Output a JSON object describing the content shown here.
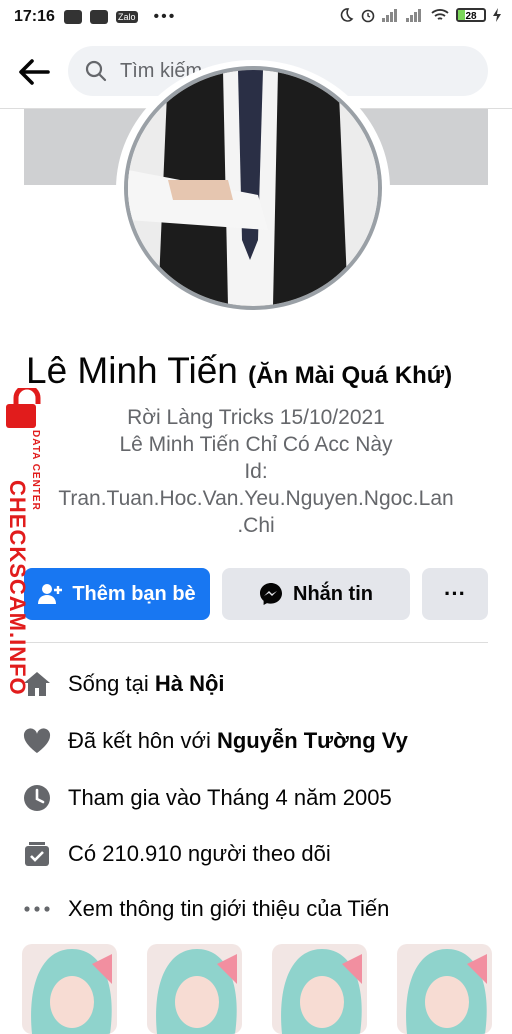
{
  "status_bar": {
    "time": "17:16",
    "battery": "28"
  },
  "search": {
    "placeholder": "Tìm kiếm"
  },
  "profile": {
    "name": "Lê Minh Tiến",
    "alternate_name": "(Ăn Mài Quá Khứ)",
    "bio_lines": [
      "Rời Làng Tricks 15/10/2021",
      "Lê Minh Tiến Chỉ Có Acc Này",
      "Id:",
      "Tran.Tuan.Hoc.Van.Yeu.Nguyen.Ngoc.Lan",
      ".Chi"
    ]
  },
  "actions": {
    "add_friend": "Thêm bạn bè",
    "message": "Nhắn tin",
    "more": "···"
  },
  "details": {
    "lives_prefix": "Sống tại ",
    "lives_place": "Hà Nội",
    "married_prefix": "Đã kết hôn với ",
    "married_name": "Nguyễn Tường Vy",
    "joined": "Tham gia vào Tháng 4 năm 2005",
    "followers": "Có 210.910 người theo dõi",
    "see_about": "Xem thông tin giới thiệu của Tiến"
  },
  "watermark": {
    "main": "CHECKSCAM.INFO",
    "sub": "DATA CENTER"
  },
  "colors": {
    "primary": "#1877f2",
    "secondary_bg": "#e4e6eb",
    "muted_text": "#65676b",
    "watermark": "#e11c1c"
  },
  "icons": [
    "back-arrow-icon",
    "search-icon",
    "add-friend-icon",
    "messenger-icon",
    "home-icon",
    "heart-icon",
    "clock-icon",
    "followers-icon",
    "more-dots-icon"
  ]
}
